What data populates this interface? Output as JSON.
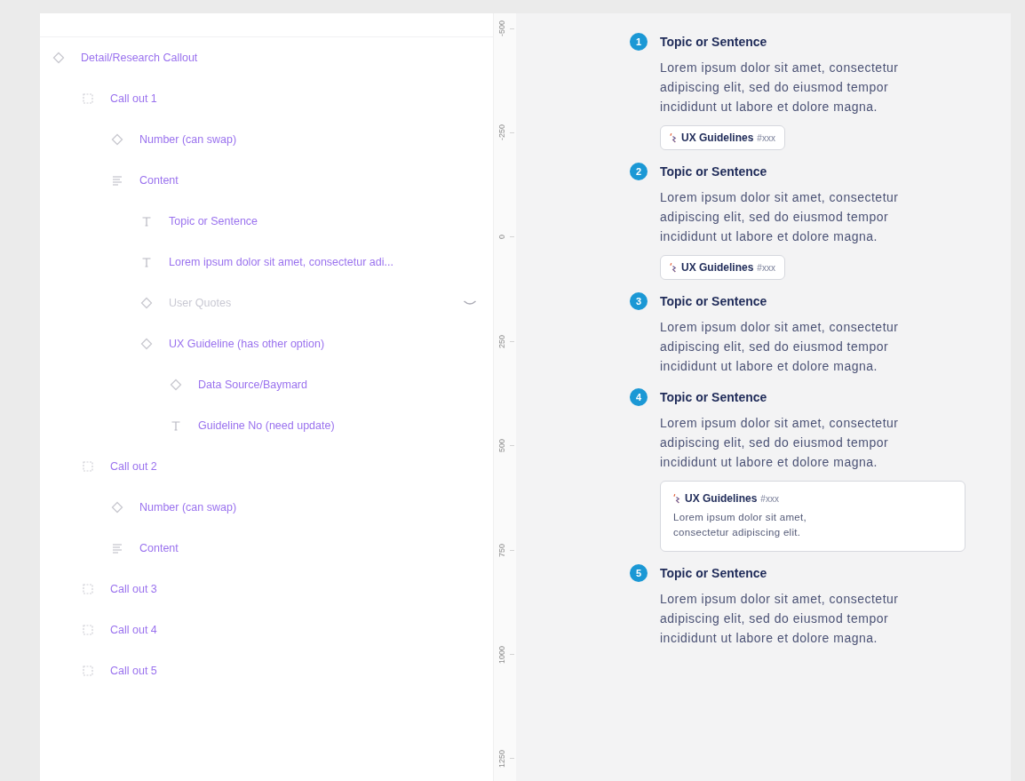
{
  "layers": [
    {
      "name": "Detail/Research Callout",
      "kind": "component",
      "hidden": false,
      "children": [
        {
          "name": "Call out 1",
          "kind": "frame",
          "hidden": false,
          "children": [
            {
              "name": "Number (can swap)",
              "kind": "instance",
              "hidden": false
            },
            {
              "name": "Content",
              "kind": "stack",
              "hidden": false,
              "children": [
                {
                  "name": "Topic or Sentence",
                  "kind": "text",
                  "hidden": false
                },
                {
                  "name": "Lorem ipsum dolor sit amet, consectetur adi...",
                  "kind": "text",
                  "hidden": false
                },
                {
                  "name": "User Quotes",
                  "kind": "instance",
                  "hidden": true
                },
                {
                  "name": "UX Guideline (has other option)",
                  "kind": "instance",
                  "hidden": false,
                  "children": [
                    {
                      "name": "Data Source/Baymard",
                      "kind": "instance",
                      "hidden": false
                    },
                    {
                      "name": "Guideline No (need update)",
                      "kind": "text",
                      "hidden": false
                    }
                  ]
                }
              ]
            }
          ]
        },
        {
          "name": "Call out 2",
          "kind": "frame",
          "hidden": false,
          "children": [
            {
              "name": "Number (can swap)",
              "kind": "instance",
              "hidden": false
            },
            {
              "name": "Content",
              "kind": "stack",
              "hidden": false
            }
          ]
        },
        {
          "name": "Call out 3",
          "kind": "frame",
          "hidden": false
        },
        {
          "name": "Call out 4",
          "kind": "frame",
          "hidden": false
        },
        {
          "name": "Call out 5",
          "kind": "frame",
          "hidden": false
        }
      ]
    }
  ],
  "ruler": [
    "-500",
    "-250",
    "0",
    "250",
    "500",
    "750",
    "1000",
    "1250"
  ],
  "callouts": [
    {
      "number": "1",
      "title": "Topic or Sentence",
      "text": "Lorem ipsum dolor sit amet, consectetur adipiscing elit, sed do eiusmod tempor incididunt ut labore et dolore magna.",
      "guideline": {
        "kind": "chip",
        "label": "UX Guidelines",
        "code": "#xxx"
      }
    },
    {
      "number": "2",
      "title": "Topic or Sentence",
      "text": "Lorem ipsum dolor sit amet, consectetur adipiscing elit, sed do eiusmod tempor incididunt ut labore et dolore magna.",
      "guideline": {
        "kind": "chip",
        "label": "UX Guidelines",
        "code": "#xxx"
      }
    },
    {
      "number": "3",
      "title": "Topic or Sentence",
      "text": "Lorem ipsum dolor sit amet, consectetur adipiscing elit, sed do eiusmod tempor incididunt ut labore et dolore magna."
    },
    {
      "number": "4",
      "title": "Topic or Sentence",
      "text": "Lorem ipsum dolor sit amet, consectetur adipiscing elit, sed do eiusmod tempor incididunt ut labore et dolore magna.",
      "guideline": {
        "kind": "card",
        "label": "UX Guidelines",
        "code": "#xxx",
        "body": "Lorem ipsum dolor sit amet, consectetur adipiscing elit."
      }
    },
    {
      "number": "5",
      "title": "Topic or Sentence",
      "text": "Lorem ipsum dolor sit amet, consectetur adipiscing elit, sed do eiusmod tempor incididunt ut labore et dolore magna."
    }
  ]
}
